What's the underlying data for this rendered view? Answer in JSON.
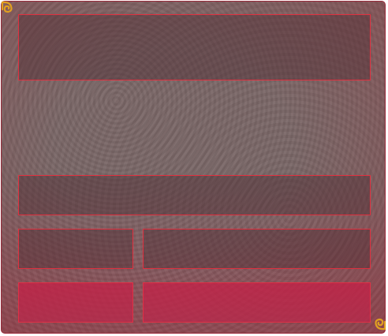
{
  "window": {
    "title": ""
  },
  "panels": {
    "header_area": "",
    "bar_full": "",
    "row1_left": "",
    "row1_right": "",
    "row2_left_button": "",
    "row2_right_button": ""
  },
  "icons": {
    "top_left": "swirl-ornament-icon",
    "bottom_right": "swirl-ornament-icon"
  },
  "colors": {
    "border_accent": "#e0303f",
    "button_fill": "#c8254a",
    "ornament": "#e0a020"
  }
}
